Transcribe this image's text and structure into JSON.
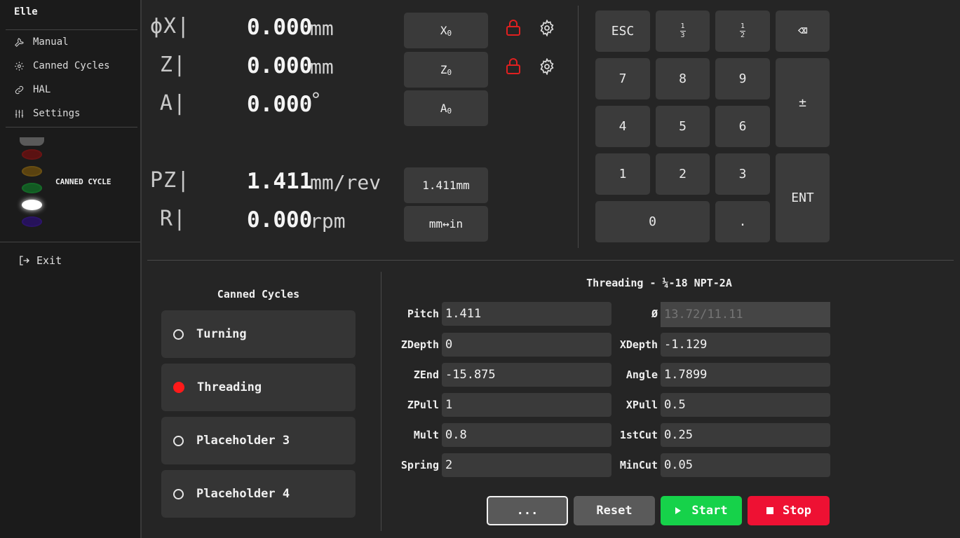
{
  "sidebar": {
    "title": "Elle",
    "nav": [
      {
        "label": "Manual",
        "icon": "wrench-icon"
      },
      {
        "label": "Canned Cycles",
        "icon": "gear-icon"
      },
      {
        "label": "HAL",
        "icon": "link-icon"
      },
      {
        "label": "Settings",
        "icon": "sliders-icon"
      }
    ],
    "status_label": "CANNED CYCLE",
    "status_leds": [
      {
        "name": "gray",
        "color": "#5a5a5a"
      },
      {
        "name": "red",
        "color": "#5a1212"
      },
      {
        "name": "amber",
        "color": "#5a4210"
      },
      {
        "name": "green",
        "color": "#135a23"
      },
      {
        "name": "white",
        "color": "#ffffff"
      },
      {
        "name": "purple",
        "color": "#26125a"
      }
    ],
    "exit_label": "Exit"
  },
  "dro": {
    "x": {
      "axis": "ϕX|",
      "value": "0.000",
      "unit": "mm",
      "zero_label": "X",
      "zero_sub": "0"
    },
    "z": {
      "axis": "Z|",
      "value": "0.000",
      "unit": "mm",
      "zero_label": "Z",
      "zero_sub": "0"
    },
    "a": {
      "axis": "A|",
      "value": "0.000",
      "unit": "°",
      "zero_label": "A",
      "zero_sub": "0"
    },
    "pz": {
      "axis": "PZ|",
      "value": "1.411",
      "unit": "mm/rev",
      "button": "1.411mm"
    },
    "r": {
      "axis": "R|",
      "value": "0.000",
      "unit": "rpm",
      "button": "mm↔in"
    }
  },
  "keypad": {
    "esc": "ESC",
    "k7": "7",
    "k8": "8",
    "k9": "9",
    "k4": "4",
    "k5": "5",
    "k6": "6",
    "k1": "1",
    "k2": "2",
    "k3": "3",
    "k0": "0",
    "dot": ".",
    "plusminus": "±",
    "ent": "ENT",
    "backspace": "⌫",
    "third_num": "1",
    "third_den": "3",
    "half_num": "1",
    "half_den": "2"
  },
  "cycles": {
    "title": "Canned Cycles",
    "items": [
      {
        "label": "Turning",
        "selected": false
      },
      {
        "label": "Threading",
        "selected": true
      },
      {
        "label": "Placeholder 3",
        "selected": false
      },
      {
        "label": "Placeholder 4",
        "selected": false
      }
    ]
  },
  "threading": {
    "title": "Threading - ¼-18 NPT-2A",
    "fields": {
      "pitch": {
        "label": "Pitch",
        "value": "1.411"
      },
      "diameter": {
        "label": "Ø",
        "placeholder": "13.72/11.11"
      },
      "zdepth": {
        "label": "ZDepth",
        "value": "0"
      },
      "xdepth": {
        "label": "XDepth",
        "value": "-1.129"
      },
      "zend": {
        "label": "ZEnd",
        "value": "-15.875"
      },
      "angle": {
        "label": "Angle",
        "value": "1.7899"
      },
      "zpull": {
        "label": "ZPull",
        "value": "1"
      },
      "xpull": {
        "label": "XPull",
        "value": "0.5"
      },
      "mult": {
        "label": "Mult",
        "value": "0.8"
      },
      "firstcut": {
        "label": "1stCut",
        "value": "0.25"
      },
      "spring": {
        "label": "Spring",
        "value": "2"
      },
      "mincut": {
        "label": "MinCut",
        "value": "0.05"
      }
    }
  },
  "actions": {
    "more": "...",
    "reset": "Reset",
    "start": "Start",
    "stop": "Stop"
  },
  "colors": {
    "lock": "#e02020",
    "start": "#16d24a",
    "stop": "#ee1133",
    "reset": "#5a5a5a"
  }
}
